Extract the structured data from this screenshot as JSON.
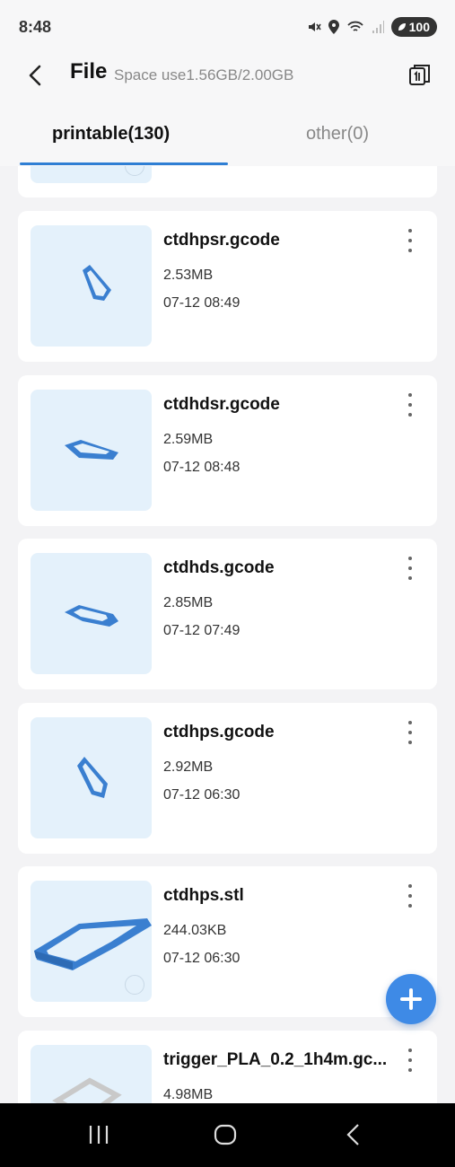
{
  "status": {
    "time": "8:48",
    "battery": "100"
  },
  "header": {
    "title": "File",
    "space_use": "Space use1.56GB/2.00GB"
  },
  "tabs": [
    {
      "label": "printable(130)",
      "active": true
    },
    {
      "label": "other(0)",
      "active": false
    }
  ],
  "files": [
    {
      "name": "ctdhpsr.gcode",
      "size": "2.53MB",
      "date": "07-12 08:49"
    },
    {
      "name": "ctdhdsr.gcode",
      "size": "2.59MB",
      "date": "07-12 08:48"
    },
    {
      "name": "ctdhds.gcode",
      "size": "2.85MB",
      "date": "07-12 07:49"
    },
    {
      "name": "ctdhps.gcode",
      "size": "2.92MB",
      "date": "07-12 06:30"
    },
    {
      "name": "ctdhps.stl",
      "size": "244.03KB",
      "date": "07-12 06:30"
    },
    {
      "name": "trigger_PLA_0.2_1h4m.gc...",
      "size": "4.98MB",
      "date": ""
    }
  ],
  "icons": {
    "back": "back-arrow-icon",
    "action": "batch-select-icon",
    "more": "more-vertical-icon",
    "add": "add-icon"
  },
  "colors": {
    "accent": "#2f7fd4",
    "thumb_bg": "#e4f1fb",
    "model": "#3a7fd0",
    "fab": "#3e8ae6"
  }
}
